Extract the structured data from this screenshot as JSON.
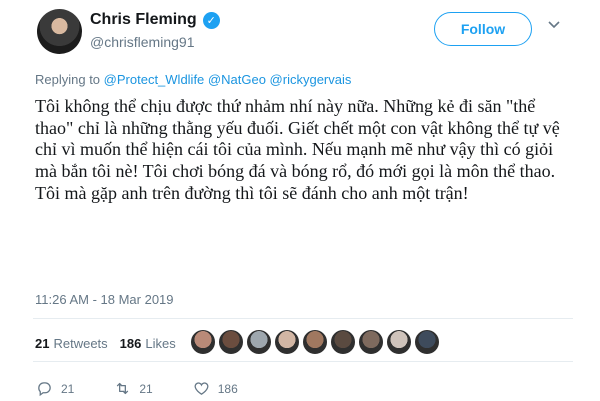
{
  "author": {
    "name": "Chris Fleming",
    "handle": "@chrisfleming91",
    "verified_glyph": "✓"
  },
  "follow_label": "Follow",
  "reply": {
    "prefix": "Replying to",
    "mentions": [
      "@Protect_Wldlife",
      "@NatGeo",
      "@rickygervais"
    ]
  },
  "tweet_text": "Tôi không thể chịu được thứ nhảm nhí này nữa. Những kẻ đi săn \"thể thao\" chỉ là những thằng yếu đuối. Giết chết một con vật không thể tự vệ chỉ vì muốn thể hiện cái tôi của mình. Nếu mạnh mẽ như vậy thì có giỏi mà bắn tôi nè! Tôi chơi bóng đá và bóng rổ, đó mới gọi là môn thể thao. Tôi mà gặp anh trên đường thì tôi sẽ đánh cho anh một trận!",
  "timestamp": "11:26 AM - 18 Mar 2019",
  "stats": {
    "retweets_count": "21",
    "retweets_label": "Retweets",
    "likes_count": "186",
    "likes_label": "Likes"
  },
  "liker_colors": [
    "#b98a78",
    "#6b4d3f",
    "#9ea7ae",
    "#d2b6a4",
    "#a07860",
    "#5a4a40",
    "#7e6a5e",
    "#cfc3bb",
    "#3e4b5c"
  ],
  "actions": {
    "reply_count": "21",
    "retweet_count": "21",
    "like_count": "186"
  },
  "colors": {
    "accent": "#1da1f2",
    "muted": "#657786",
    "link": "#1b95e0",
    "retweet_green": "#17bf63"
  }
}
